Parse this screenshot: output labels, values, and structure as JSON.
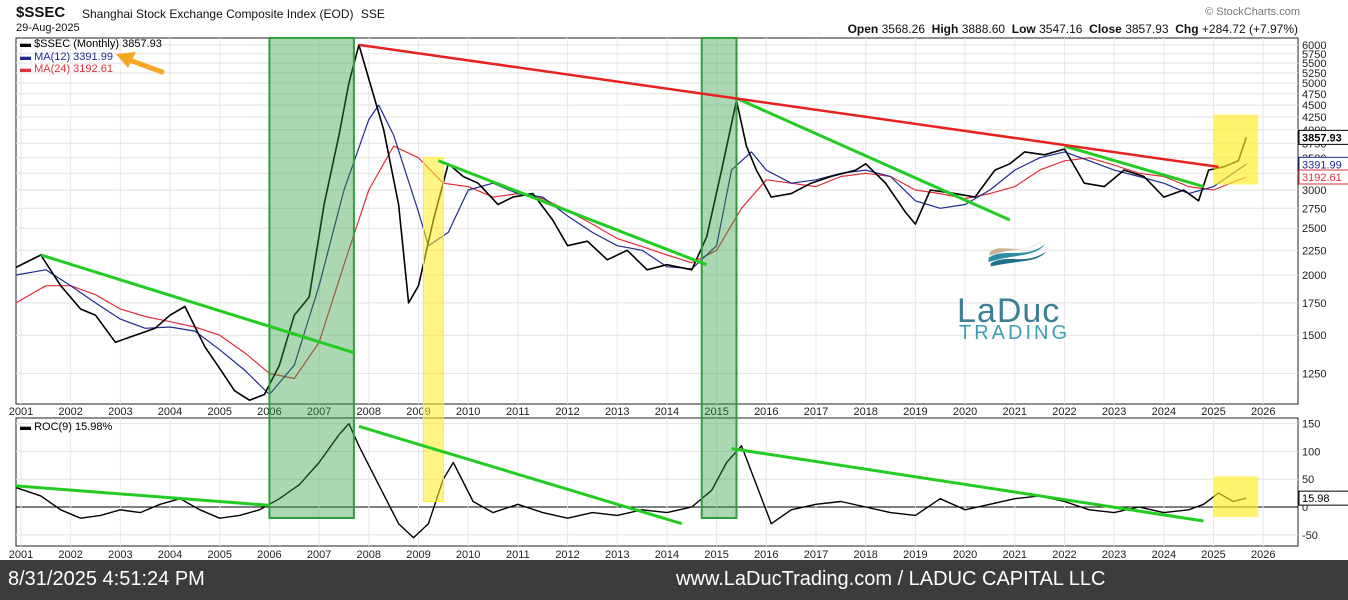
{
  "header": {
    "symbol": "$SSEC",
    "name": "Shanghai Stock Exchange Composite Index (EOD)",
    "exchange": "SSE",
    "date": "29-Aug-2025",
    "source": "© StockCharts.com",
    "open_label": "Open",
    "open": "3568.26",
    "high_label": "High",
    "high": "3888.60",
    "low_label": "Low",
    "low": "3547.16",
    "close_label": "Close",
    "close": "3857.93",
    "chg_label": "Chg",
    "chg": "+284.72 (+7.97%)"
  },
  "legend": {
    "price": "$SSEC (Monthly) 3857.93",
    "ma12": "MA(12) 3391.99",
    "ma24": "MA(24) 3192.61"
  },
  "price_labels": {
    "close": "3857.93",
    "ma12": "3391.99",
    "ma24": "3192.61"
  },
  "roc_legend": "ROC(9) 15.98%",
  "roc_label": "15.98",
  "logo": {
    "word": "LaDuc",
    "sub": "TRADING"
  },
  "footer": {
    "timestamp": "8/31/2025 4:51:24 PM",
    "site": "www.LaDucTrading.com / LADUC CAPITAL LLC"
  },
  "colors": {
    "price": "#000000",
    "ma12": "#1f2b8f",
    "ma24": "#e0303c",
    "trend_green": "#22cc22",
    "trend_red": "#e82020",
    "green_box": "#2e9e3e",
    "yellow_box": "#ffee22",
    "arrow": "#f5a623"
  },
  "chart_data": [
    {
      "type": "line",
      "title": "",
      "scale": "log",
      "ylim": [
        1080,
        6200
      ],
      "xlim": [
        2000.9,
        2026.7
      ],
      "y_ticks": [
        1250,
        1500,
        1750,
        2000,
        2250,
        2500,
        2750,
        3000,
        3250,
        3500,
        3750,
        4000,
        4250,
        4500,
        4750,
        5000,
        5250,
        5500,
        5750,
        6000
      ],
      "x_ticks": [
        2001,
        2002,
        2003,
        2004,
        2005,
        2006,
        2007,
        2008,
        2009,
        2010,
        2011,
        2012,
        2013,
        2014,
        2015,
        2016,
        2017,
        2018,
        2019,
        2020,
        2021,
        2022,
        2023,
        2024,
        2025,
        2026
      ],
      "grid": true,
      "legend_position": "top-left",
      "series": [
        {
          "name": "$SSEC (Monthly)",
          "x": [
            2000.9,
            2001.4,
            2001.8,
            2002.2,
            2002.5,
            2002.9,
            2003.3,
            2003.7,
            2004.0,
            2004.3,
            2004.7,
            2005.0,
            2005.3,
            2005.6,
            2005.9,
            2006.2,
            2006.5,
            2006.8,
            2007.1,
            2007.4,
            2007.6,
            2007.8,
            2008.0,
            2008.3,
            2008.6,
            2008.8,
            2009.0,
            2009.3,
            2009.6,
            2009.9,
            2010.2,
            2010.6,
            2010.9,
            2011.3,
            2011.7,
            2012.0,
            2012.4,
            2012.8,
            2013.2,
            2013.6,
            2014.0,
            2014.5,
            2014.8,
            2015.1,
            2015.4,
            2015.6,
            2015.8,
            2016.1,
            2016.5,
            2016.9,
            2017.3,
            2017.8,
            2018.0,
            2018.4,
            2018.8,
            2019.0,
            2019.3,
            2019.8,
            2020.2,
            2020.6,
            2020.9,
            2021.2,
            2021.6,
            2022.0,
            2022.4,
            2022.8,
            2023.2,
            2023.6,
            2024.0,
            2024.4,
            2024.7,
            2024.9,
            2025.2,
            2025.5,
            2025.66
          ],
          "values": [
            2073,
            2200,
            1900,
            1700,
            1650,
            1450,
            1500,
            1550,
            1650,
            1720,
            1420,
            1280,
            1150,
            1100,
            1130,
            1300,
            1650,
            1800,
            2800,
            3900,
            5000,
            6000,
            5100,
            4000,
            2800,
            1750,
            1900,
            2600,
            3400,
            3200,
            3100,
            2800,
            2900,
            2950,
            2600,
            2300,
            2350,
            2150,
            2250,
            2050,
            2100,
            2050,
            2400,
            3300,
            4600,
            3700,
            3300,
            2900,
            2950,
            3100,
            3200,
            3300,
            3400,
            3100,
            2700,
            2550,
            3000,
            2950,
            2900,
            3300,
            3400,
            3600,
            3550,
            3650,
            3100,
            3050,
            3300,
            3200,
            2900,
            3000,
            2850,
            3300,
            3350,
            3450,
            3857.93
          ]
        },
        {
          "name": "MA(12)",
          "x": [
            2000.9,
            2001.5,
            2002.0,
            2002.5,
            2003.0,
            2003.5,
            2004.0,
            2004.5,
            2005.0,
            2005.5,
            2006.0,
            2006.5,
            2007.0,
            2007.5,
            2008.0,
            2008.2,
            2008.5,
            2009.0,
            2009.2,
            2009.6,
            2010.0,
            2010.5,
            2011.0,
            2011.5,
            2012.0,
            2012.5,
            2013.0,
            2013.5,
            2014.0,
            2014.5,
            2015.0,
            2015.3,
            2015.7,
            2016.0,
            2016.5,
            2017.0,
            2017.5,
            2018.0,
            2018.5,
            2019.0,
            2019.5,
            2020.0,
            2020.5,
            2021.0,
            2021.5,
            2022.0,
            2022.5,
            2023.0,
            2023.5,
            2024.0,
            2024.5,
            2025.0,
            2025.66
          ],
          "values": [
            2000,
            2050,
            1900,
            1750,
            1620,
            1550,
            1560,
            1530,
            1400,
            1270,
            1130,
            1300,
            1900,
            3000,
            4200,
            4500,
            3900,
            2700,
            2300,
            2450,
            3000,
            3100,
            2950,
            2900,
            2650,
            2450,
            2300,
            2250,
            2080,
            2060,
            2300,
            3300,
            3600,
            3300,
            3100,
            3150,
            3250,
            3300,
            3200,
            2850,
            2750,
            2800,
            3000,
            3300,
            3500,
            3600,
            3450,
            3300,
            3200,
            3100,
            2950,
            3050,
            3391.99
          ]
        },
        {
          "name": "MA(24)",
          "x": [
            2000.9,
            2001.5,
            2002.0,
            2002.5,
            2003.0,
            2003.5,
            2004.0,
            2004.5,
            2005.0,
            2005.5,
            2006.0,
            2006.5,
            2007.0,
            2007.5,
            2008.0,
            2008.5,
            2009.0,
            2009.5,
            2010.0,
            2010.5,
            2011.0,
            2011.5,
            2012.0,
            2012.5,
            2013.0,
            2013.5,
            2014.0,
            2014.5,
            2015.0,
            2015.5,
            2016.0,
            2016.5,
            2017.0,
            2017.5,
            2018.0,
            2018.5,
            2019.0,
            2019.5,
            2020.0,
            2020.5,
            2021.0,
            2021.5,
            2022.0,
            2022.5,
            2023.0,
            2023.5,
            2024.0,
            2024.5,
            2025.0,
            2025.66
          ],
          "values": [
            1750,
            1900,
            1900,
            1820,
            1700,
            1640,
            1600,
            1560,
            1500,
            1380,
            1250,
            1220,
            1450,
            2100,
            3000,
            3700,
            3500,
            3100,
            3050,
            2900,
            2950,
            2880,
            2720,
            2550,
            2380,
            2290,
            2200,
            2120,
            2250,
            2750,
            3150,
            3100,
            3050,
            3200,
            3250,
            3200,
            3000,
            2950,
            2880,
            2950,
            3050,
            3300,
            3450,
            3500,
            3380,
            3250,
            3200,
            3050,
            3000,
            3192.61
          ]
        }
      ]
    },
    {
      "type": "line",
      "title": "",
      "ylim": [
        -70,
        160
      ],
      "y_ticks": [
        -50,
        0,
        50,
        100,
        150
      ],
      "x_ticks": [
        2001,
        2002,
        2003,
        2004,
        2005,
        2006,
        2007,
        2008,
        2009,
        2010,
        2011,
        2012,
        2013,
        2014,
        2015,
        2016,
        2017,
        2018,
        2019,
        2020,
        2021,
        2022,
        2023,
        2024,
        2025,
        2026
      ],
      "grid": true,
      "series": [
        {
          "name": "ROC(9)",
          "x": [
            2000.9,
            2001.4,
            2001.8,
            2002.2,
            2002.6,
            2003.0,
            2003.4,
            2003.8,
            2004.2,
            2004.6,
            2005.0,
            2005.4,
            2005.8,
            2006.2,
            2006.6,
            2007.0,
            2007.4,
            2007.6,
            2007.8,
            2008.2,
            2008.6,
            2008.9,
            2009.2,
            2009.5,
            2009.7,
            2010.1,
            2010.5,
            2011.0,
            2011.5,
            2012.0,
            2012.5,
            2013.0,
            2013.5,
            2014.0,
            2014.5,
            2014.9,
            2015.2,
            2015.5,
            2015.8,
            2016.1,
            2016.5,
            2017.0,
            2017.5,
            2018.0,
            2018.5,
            2019.0,
            2019.5,
            2020.0,
            2020.5,
            2021.0,
            2021.5,
            2022.0,
            2022.5,
            2023.0,
            2023.5,
            2024.0,
            2024.5,
            2024.8,
            2025.1,
            2025.4,
            2025.66
          ],
          "values": [
            35,
            20,
            -5,
            -20,
            -15,
            -5,
            -10,
            5,
            15,
            -5,
            -20,
            -15,
            -5,
            15,
            40,
            80,
            130,
            150,
            110,
            40,
            -30,
            -55,
            -30,
            50,
            80,
            10,
            -10,
            5,
            -10,
            -20,
            -10,
            -15,
            -5,
            -10,
            0,
            30,
            80,
            110,
            40,
            -30,
            -5,
            5,
            10,
            0,
            -10,
            -15,
            15,
            -5,
            5,
            15,
            20,
            10,
            -5,
            -10,
            0,
            -10,
            -5,
            5,
            25,
            10,
            15.98
          ]
        }
      ]
    }
  ]
}
